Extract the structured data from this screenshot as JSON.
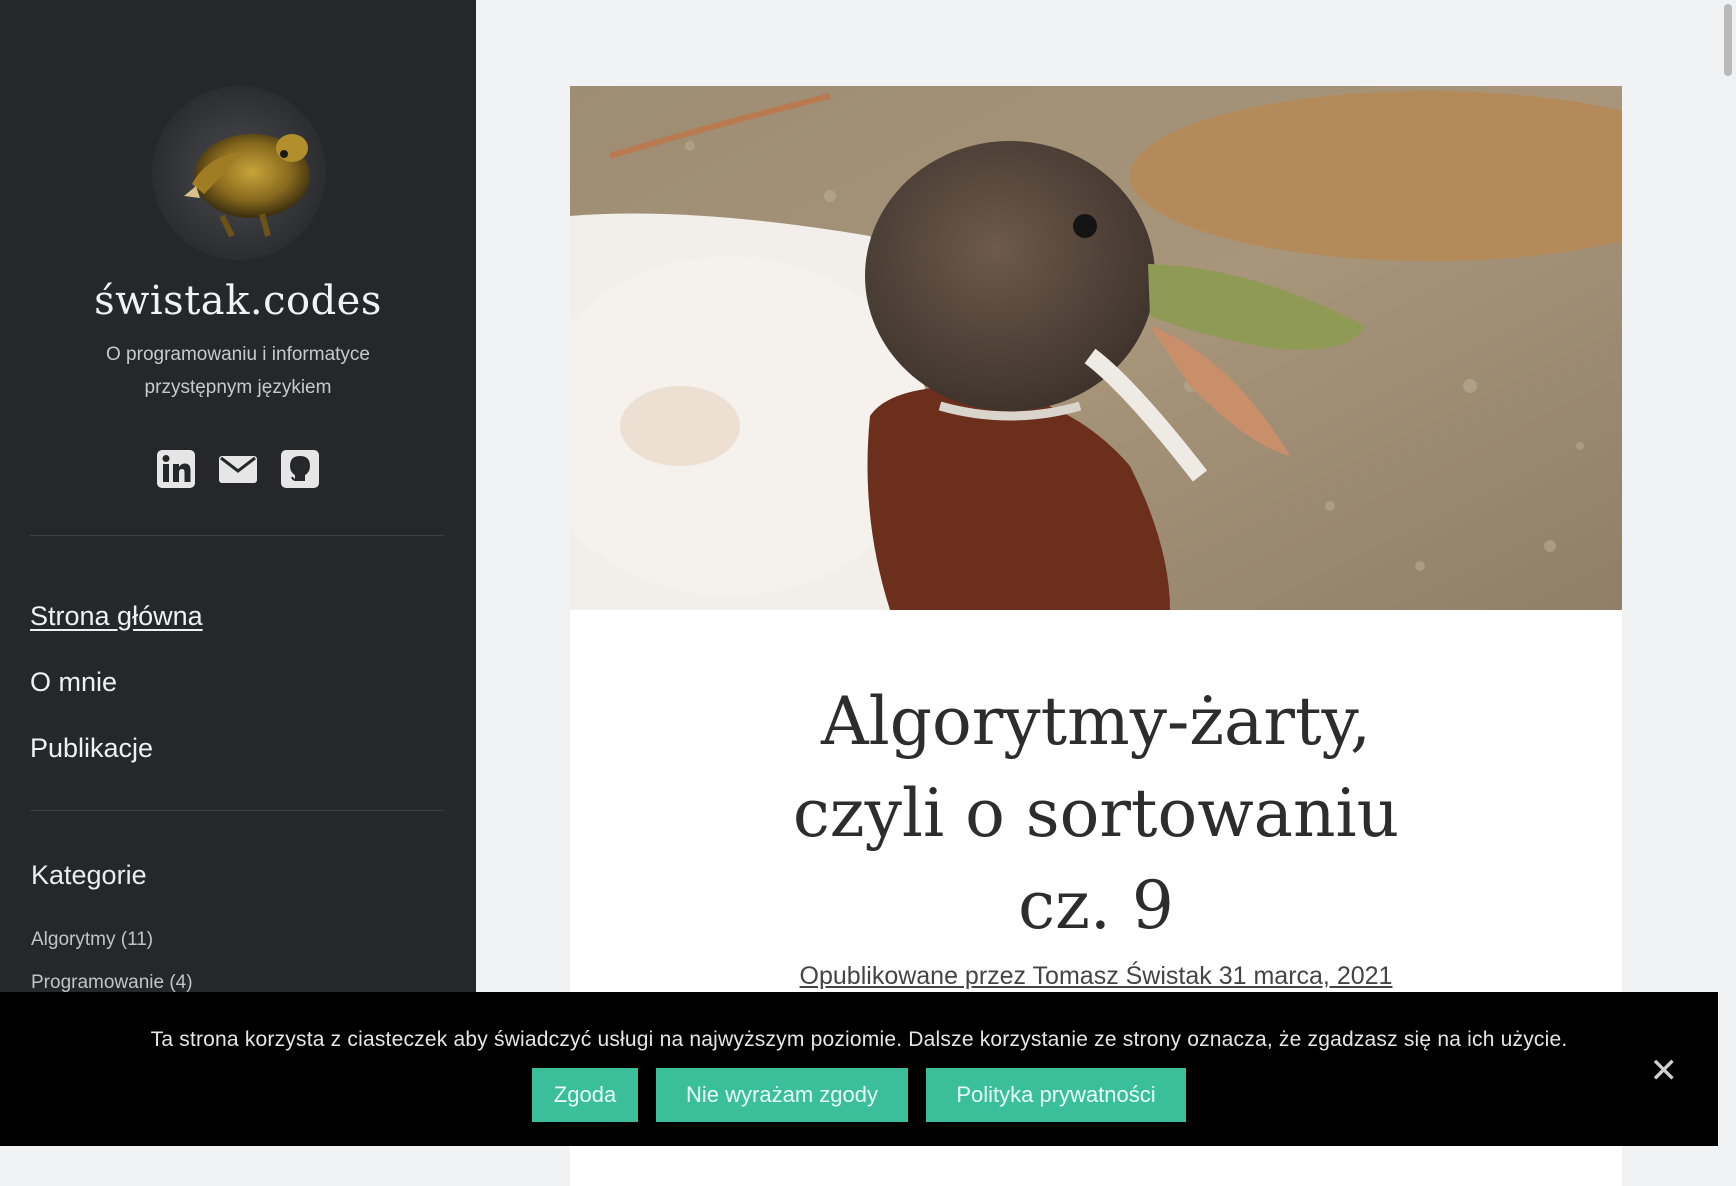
{
  "sidebar": {
    "site_title": "świstak.codes",
    "tagline_line1": "O programowaniu i informatyce",
    "tagline_line2": "przystępnym językiem",
    "social": [
      {
        "icon": "linkedin-icon"
      },
      {
        "icon": "envelope-icon"
      },
      {
        "icon": "github-icon"
      }
    ],
    "nav": [
      {
        "label": "Strona główna"
      },
      {
        "label": "O mnie"
      },
      {
        "label": "Publikacje"
      }
    ],
    "categories_heading": "Kategorie",
    "categories": [
      {
        "label": "Algorytmy (11)"
      },
      {
        "label": "Programowanie (4)"
      }
    ]
  },
  "post": {
    "title_line1": "Algorytmy-żarty,",
    "title_line2": "czyli o sortowaniu",
    "title_line3": "cz. 9",
    "byline": "Opublikowane przez Tomasz Świstak 31 marca, 2021"
  },
  "cookie_banner": {
    "text": "Ta strona korzysta z ciasteczek aby świadczyć usługi na najwyższym poziomie. Dalsze korzystanie ze strony oznacza, że zgadzasz się na ich użycie.",
    "accept_label": "Zgoda",
    "decline_label": "Nie wyrażam zgody",
    "privacy_label": "Polityka prywatności",
    "close_label": "✕"
  },
  "colors": {
    "sidebar_bg": "#25272b",
    "button_accent": "#3bbf9a",
    "banner_bg": "#000000"
  }
}
